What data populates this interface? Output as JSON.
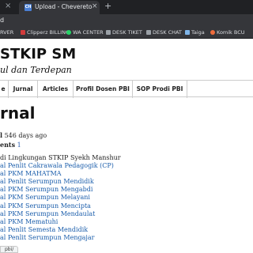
{
  "browser": {
    "prev_tab_close": "×",
    "active_tab": {
      "favicon": "CH",
      "title": "Upload - Chevereto",
      "close": "×"
    },
    "new_tab": "+",
    "address": "d"
  },
  "bookmarks": [
    {
      "label": "RVER",
      "color": ""
    },
    {
      "label": "Clipperz BILLING",
      "color": "#d23b3b"
    },
    {
      "label": "WA CENTER",
      "color": "#25d366"
    },
    {
      "label": "DESK TIKET",
      "color": "#9aa0a6"
    },
    {
      "label": "DESK CHAT",
      "color": "#9aa0a6"
    },
    {
      "label": "Taiga",
      "color": "#7fb5e8"
    },
    {
      "label": "Komik BCU",
      "color": "#ef6c3c"
    }
  ],
  "site": {
    "title": "STKIP SM",
    "tagline": "ul dan Terdepan"
  },
  "nav": [
    "e",
    "Jurnal",
    "Articles",
    "Profil Dosen PBI",
    "SOP Prodi PBI"
  ],
  "page": {
    "heading": "rnal",
    "updated_label": "l",
    "updated_value": "546 days ago",
    "comments_label": "ents",
    "comments_value": "1"
  },
  "links": [
    {
      "text": "di Lingkungan STKIP Syekh Manshur",
      "link": false
    },
    {
      "text": "al Penlit Cakrawala Pedagogik (CP)",
      "link": true
    },
    {
      "text": "al PKM MAHATMA",
      "link": true
    },
    {
      "text": "al Penlit Serumpun Mendidik",
      "link": true
    },
    {
      "text": "al PKM Serumpun Mengabdi",
      "link": true
    },
    {
      "text": "al PKM Serumpun Melayani",
      "link": true
    },
    {
      "text": "al PKM Serumpun Mencipta",
      "link": true
    },
    {
      "text": "al PKM Serumpun Mendaulat",
      "link": true
    },
    {
      "text": "al PKM Mematuhi",
      "link": true
    },
    {
      "text": "al Penlit Semesta Mendidik",
      "link": true
    },
    {
      "text": "al Penlit Serumpun Mengajar",
      "link": true
    }
  ],
  "status_bar": "pbi/"
}
